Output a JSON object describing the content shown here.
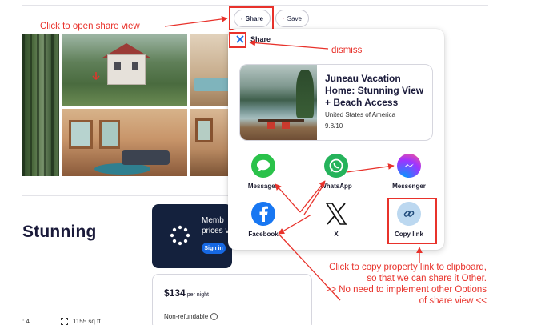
{
  "topbar": {
    "share_label": "Share",
    "save_label": "Save"
  },
  "listing": {
    "title_partial": "Stunning",
    "member_text": "Memb\nprices v",
    "signin_label": "Sign in",
    "price": "$134",
    "price_unit": "per night",
    "refund": "Non-refundable",
    "beds": "4",
    "area": "1155 sq ft"
  },
  "share_sheet": {
    "title": "Share",
    "property": {
      "name": "Juneau Vacation Home: Stunning View + Beach Access",
      "country": "United States of America",
      "rating": "9.8/10"
    },
    "options": [
      {
        "label": "Messages",
        "icon": "messages-icon"
      },
      {
        "label": "WhatsApp",
        "icon": "whatsapp-icon"
      },
      {
        "label": "Messenger",
        "icon": "messenger-icon"
      },
      {
        "label": "Facebook",
        "icon": "facebook-icon"
      },
      {
        "label": "X",
        "icon": "x-logo-icon"
      },
      {
        "label": "Copy link",
        "icon": "link-icon"
      }
    ]
  },
  "annotations": {
    "open_share": "Click to open share view",
    "dismiss": "dismiss",
    "copy_note": "Click to copy property link to clipboard, so that we can share it Other.\n>> No need to implement other Options of share view <<"
  },
  "colors": {
    "annotation": "#e8322b",
    "brand_blue": "#1668e3",
    "navy": "#14213d"
  }
}
